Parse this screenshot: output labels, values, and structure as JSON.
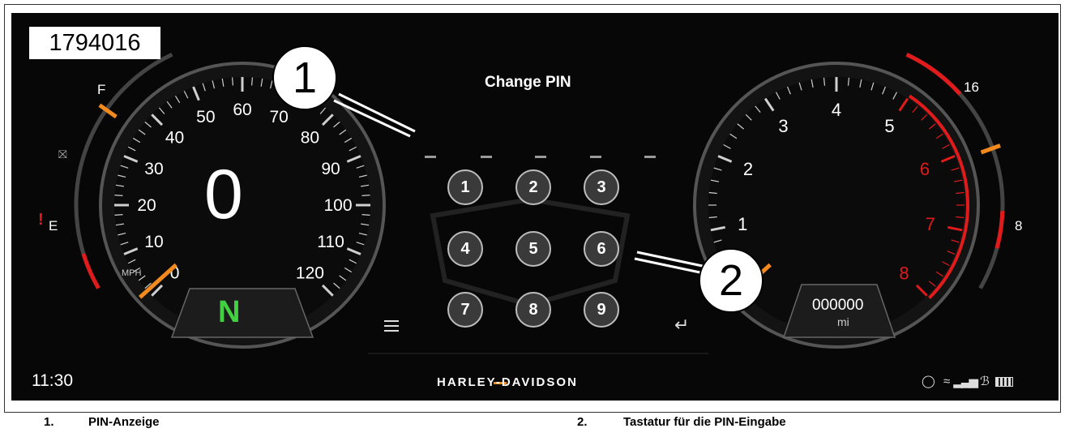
{
  "figure_id": "1794016",
  "dashboard": {
    "pin_title": "Change PIN",
    "speed_value": "0",
    "speed_unit": "MPH",
    "gear": "N",
    "speed_ticks": [
      "10",
      "20",
      "30",
      "40",
      "50",
      "60",
      "70",
      "80",
      "90",
      "100",
      "110",
      "120"
    ],
    "speed_tick_zero": "0",
    "fuel_full": "F",
    "fuel_empty": "E",
    "rpm_ticks": [
      "1",
      "2",
      "3",
      "4",
      "5",
      "6",
      "7",
      "8"
    ],
    "temp_high": "16",
    "temp_low": "8",
    "odometer_value": "000000",
    "odometer_unit": "mi",
    "clock": "11:30",
    "brand": "HARLEY-DAVIDSON",
    "keypad": [
      "1",
      "2",
      "3",
      "4",
      "5",
      "6",
      "7",
      "8",
      "9"
    ],
    "accent_orange": "#f28a1e",
    "accent_red": "#e11b1b",
    "gear_green": "#3fd13f"
  },
  "callouts": [
    "1",
    "2"
  ],
  "captions": [
    {
      "number": "1.",
      "text": "PIN-Anzeige"
    },
    {
      "number": "2.",
      "text": "Tastatur für die PIN-Eingabe"
    }
  ]
}
